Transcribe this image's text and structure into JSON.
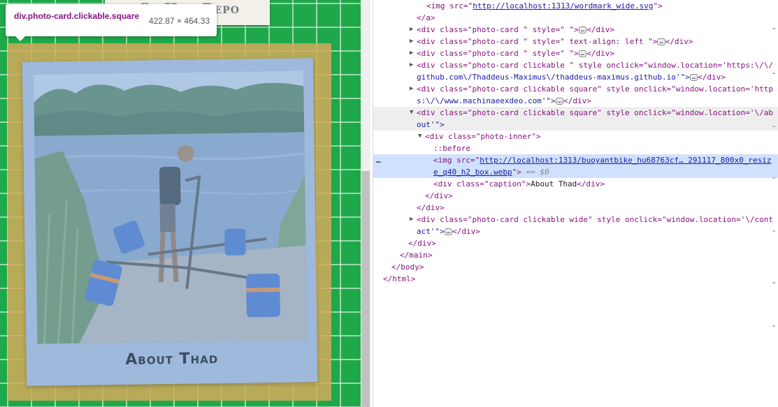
{
  "tooltip": {
    "selector": "div.photo-card.clickable.square",
    "size": "422.87 × 464.33"
  },
  "page": {
    "previous_card_text": "GitHub Repo",
    "caption": "About Thad"
  },
  "colors": {
    "grid_green": "#1fa84a",
    "card_blue": "#9fb9dc",
    "highlight": "#d2aa5a",
    "selected_line": "#cfe1fc",
    "tag": "#881280",
    "attr_name": "#994500",
    "attr_value": "#1a1aa6"
  },
  "dom": {
    "l0_pre": "<img src=\"",
    "l0_url": "http://localhost:1313/wordmark_wide.svg",
    "l0_post": "\">",
    "l1": "</a>",
    "l2_a": "<div class=\"photo-card \" style=\"  \">",
    "l2_b": "</div>",
    "l3_a": "<div class=\"photo-card \" style=\" text-align: left \">",
    "l3_b": "</div>",
    "l4_a": "<div class=\"photo-card \" style=\"  \">",
    "l4_b": "</div>",
    "l5_a": "<div class=\"photo-card clickable \" style onclick=\"window.location='https:\\/\\/",
    "l6_a": "github.com\\/Thaddeus-Maximus\\/thaddeus-maximus.github.io'\">",
    "l6_b": "</div>",
    "l7_a": "<div class=\"photo-card clickable square\" style onclick=\"window.location='http",
    "l8_a": "s:\\/\\/www.machinaeexdeo.com'\">",
    "l8_b": "</div>",
    "l9_a": "<div class=\"photo-card clickable square\" style onclick=\"window.location='\\/ab",
    "l10_a": "out'\">",
    "l11_a": "<div class=\"photo-inner\">",
    "l12": "::before",
    "l13_pre": "<img src=\"",
    "l13_url": "http://localhost:1313/buoyantbike_hu68763cf… 291117_800x0_resiz",
    "l14_url": "e_q40_h2_box.webp",
    "l14_post": "\">",
    "l14_eq": "== $0",
    "l15_a": "<div class=\"caption\">",
    "l15_txt": "About Thad",
    "l15_b": "</div>",
    "l16": "</div>",
    "l17": "</div>",
    "l18_a": "<div class=\"photo-card clickable wide\" style onclick=\"window.location='\\/cont",
    "l19_a": "act'\">",
    "l19_b": "</div>",
    "l20": "</div>",
    "l21": "</main>",
    "l22": "</body>",
    "l23": "</html>",
    "ellipsis": "…",
    "selected_marker": "…"
  }
}
